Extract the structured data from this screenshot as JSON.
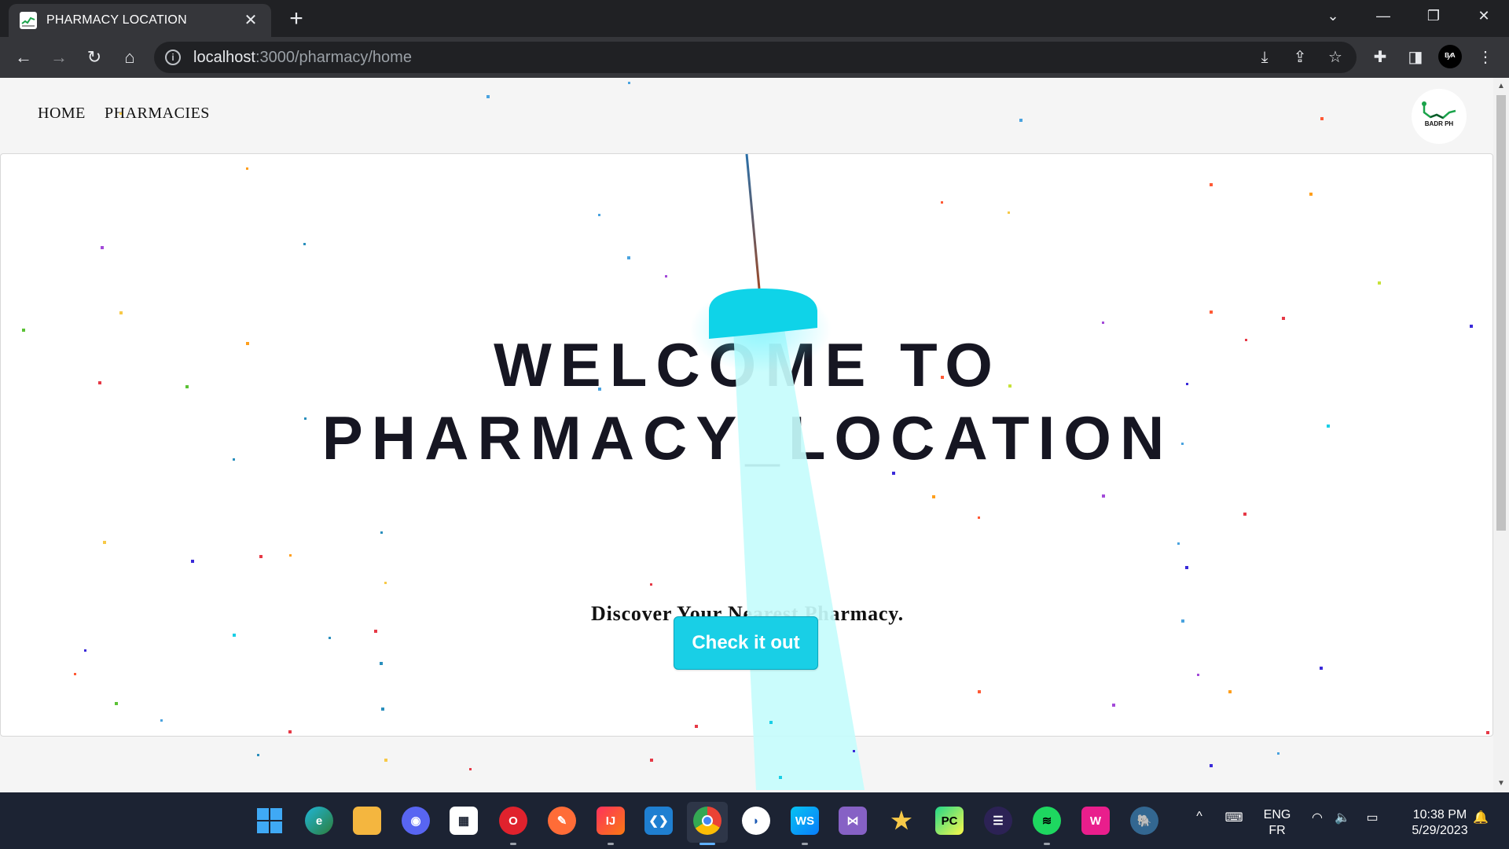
{
  "browser": {
    "tab_title": "PHARMACY LOCATION",
    "new_tab": "+",
    "close_tab": "✕",
    "url_host": "localhost",
    "url_path": ":3000/pharmacy/home",
    "profile_initials": "ᴮ⁄ᴬ"
  },
  "nav": {
    "links": [
      "HOME",
      "PHARMACIES"
    ],
    "logo_text": "BADR PH"
  },
  "hero": {
    "title_line1": "WELCOME TO",
    "title_line2": "PHARMACY_LOCATION",
    "subtitle": "Discover Your Nearest Pharmacy.",
    "cta_label": "Check it out"
  },
  "colors": {
    "accent": "#19cfe6",
    "beam": "#c6fcfc",
    "lamp": "#0fd3e8",
    "title": "#161622",
    "taskbar": "#1c2333"
  },
  "taskbar": {
    "apps": [
      "start-icon",
      "edge-icon",
      "file-explorer-icon",
      "discord-icon",
      "microsoft-store-icon",
      "opera-icon",
      "postman-icon",
      "intellij-icon",
      "vscode-icon",
      "chrome-icon",
      "app-icon",
      "webstorm-icon",
      "visual-studio-icon",
      "starred-app-icon",
      "pycharm-icon",
      "eclipse-icon",
      "spotify-icon",
      "wamp-icon",
      "postgresql-icon"
    ],
    "language_top": "ENG",
    "language_bottom": "FR",
    "time": "10:38 PM",
    "date": "5/29/2023"
  }
}
